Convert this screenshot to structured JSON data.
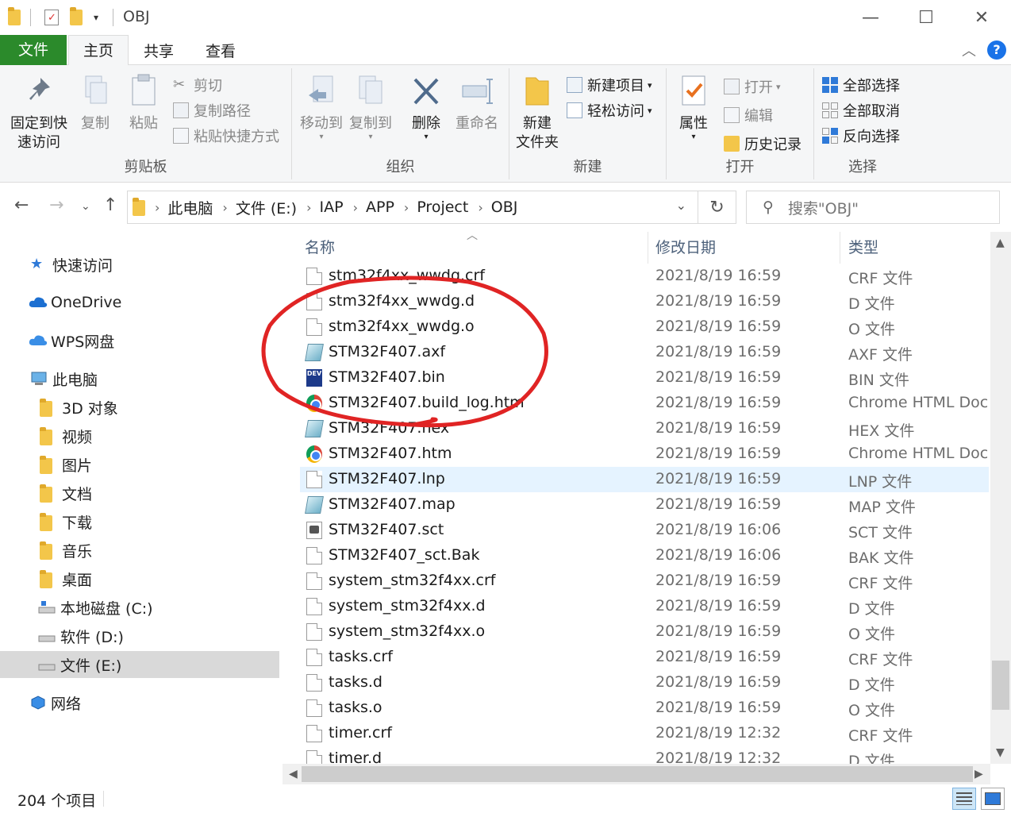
{
  "window": {
    "title": "OBJ",
    "minimize": "—",
    "maximize": "☐",
    "close": "✕"
  },
  "tabs": {
    "file": "文件",
    "home": "主页",
    "share": "共享",
    "view": "查看"
  },
  "ribbon": {
    "clipboard": {
      "label": "剪贴板",
      "pin_line1": "固定到快",
      "pin_line2": "速访问",
      "copy": "复制",
      "paste": "粘贴",
      "cut": "剪切",
      "copy_path": "复制路径",
      "paste_shortcut": "粘贴快捷方式"
    },
    "organize": {
      "label": "组织",
      "move_to": "移动到",
      "copy_to": "复制到",
      "delete": "删除",
      "rename": "重命名"
    },
    "new": {
      "label": "新建",
      "new_folder_line1": "新建",
      "new_folder_line2": "文件夹",
      "new_item": "新建项目",
      "easy_access": "轻松访问"
    },
    "open": {
      "label": "打开",
      "properties": "属性",
      "open": "打开",
      "edit": "编辑",
      "history": "历史记录"
    },
    "select": {
      "label": "选择",
      "select_all": "全部选择",
      "select_none": "全部取消",
      "invert": "反向选择"
    }
  },
  "address": {
    "crumbs": [
      "此电脑",
      "文件 (E:)",
      "IAP",
      "APP",
      "Project",
      "OBJ"
    ],
    "search_placeholder": "搜索\"OBJ\""
  },
  "navpane": {
    "items": [
      {
        "label": "快速访问",
        "icon": "star-icon"
      },
      {
        "label": "OneDrive",
        "icon": "cloud-icon"
      },
      {
        "label": "WPS网盘",
        "icon": "cloud-icon"
      },
      {
        "label": "此电脑",
        "icon": "computer-icon"
      },
      {
        "label": "3D 对象",
        "icon": "folder-icon"
      },
      {
        "label": "视频",
        "icon": "folder-icon"
      },
      {
        "label": "图片",
        "icon": "folder-icon"
      },
      {
        "label": "文档",
        "icon": "folder-icon"
      },
      {
        "label": "下载",
        "icon": "folder-icon"
      },
      {
        "label": "音乐",
        "icon": "folder-icon"
      },
      {
        "label": "桌面",
        "icon": "folder-icon"
      },
      {
        "label": "本地磁盘 (C:)",
        "icon": "drive-icon"
      },
      {
        "label": "软件 (D:)",
        "icon": "drive-icon"
      },
      {
        "label": "文件 (E:)",
        "icon": "drive-icon"
      },
      {
        "label": "网络",
        "icon": "network-icon"
      }
    ]
  },
  "filelist": {
    "columns": {
      "name": "名称",
      "date": "修改日期",
      "type": "类型"
    },
    "rows": [
      {
        "name": "stm32f4xx_wwdg.crf",
        "date": "2021/8/19 16:59",
        "type": "CRF 文件",
        "icon": "doc"
      },
      {
        "name": "stm32f4xx_wwdg.d",
        "date": "2021/8/19 16:59",
        "type": "D 文件",
        "icon": "doc"
      },
      {
        "name": "stm32f4xx_wwdg.o",
        "date": "2021/8/19 16:59",
        "type": "O 文件",
        "icon": "doc"
      },
      {
        "name": "STM32F407.axf",
        "date": "2021/8/19 16:59",
        "type": "AXF 文件",
        "icon": "axf"
      },
      {
        "name": "STM32F407.bin",
        "date": "2021/8/19 16:59",
        "type": "BIN 文件",
        "icon": "dev"
      },
      {
        "name": "STM32F407.build_log.htm",
        "date": "2021/8/19 16:59",
        "type": "Chrome HTML Doc...",
        "icon": "chrome"
      },
      {
        "name": "STM32F407.hex",
        "date": "2021/8/19 16:59",
        "type": "HEX 文件",
        "icon": "axf"
      },
      {
        "name": "STM32F407.htm",
        "date": "2021/8/19 16:59",
        "type": "Chrome HTML Doc...",
        "icon": "chrome"
      },
      {
        "name": "STM32F407.lnp",
        "date": "2021/8/19 16:59",
        "type": "LNP 文件",
        "icon": "doc"
      },
      {
        "name": "STM32F407.map",
        "date": "2021/8/19 16:59",
        "type": "MAP 文件",
        "icon": "axf"
      },
      {
        "name": "STM32F407.sct",
        "date": "2021/8/19 16:06",
        "type": "SCT 文件",
        "icon": "sct"
      },
      {
        "name": "STM32F407_sct.Bak",
        "date": "2021/8/19 16:06",
        "type": "BAK 文件",
        "icon": "doc"
      },
      {
        "name": "system_stm32f4xx.crf",
        "date": "2021/8/19 16:59",
        "type": "CRF 文件",
        "icon": "doc"
      },
      {
        "name": "system_stm32f4xx.d",
        "date": "2021/8/19 16:59",
        "type": "D 文件",
        "icon": "doc"
      },
      {
        "name": "system_stm32f4xx.o",
        "date": "2021/8/19 16:59",
        "type": "O 文件",
        "icon": "doc"
      },
      {
        "name": "tasks.crf",
        "date": "2021/8/19 16:59",
        "type": "CRF 文件",
        "icon": "doc"
      },
      {
        "name": "tasks.d",
        "date": "2021/8/19 16:59",
        "type": "D 文件",
        "icon": "doc"
      },
      {
        "name": "tasks.o",
        "date": "2021/8/19 16:59",
        "type": "O 文件",
        "icon": "doc"
      },
      {
        "name": "timer.crf",
        "date": "2021/8/19 12:32",
        "type": "CRF 文件",
        "icon": "doc"
      },
      {
        "name": "timer.d",
        "date": "2021/8/19 12:32",
        "type": "D 文件",
        "icon": "doc"
      }
    ]
  },
  "status": {
    "count": "204 个项目"
  },
  "colors": {
    "file_tab": "#2b8a2b",
    "accent": "#1a73e8",
    "annotation": "#e02424"
  }
}
